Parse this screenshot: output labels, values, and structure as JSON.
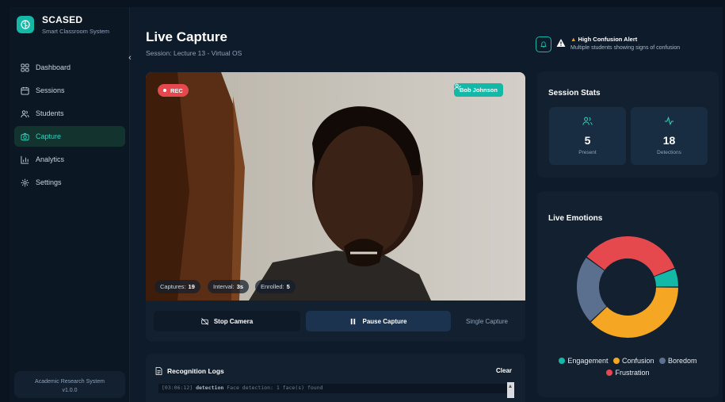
{
  "sidebar": {
    "brand_name": "SCASED",
    "brand_sub": "Smart Classroom System",
    "items": [
      {
        "label": "Dashboard",
        "icon": "grid-icon"
      },
      {
        "label": "Sessions",
        "icon": "calendar-icon"
      },
      {
        "label": "Students",
        "icon": "users-icon"
      },
      {
        "label": "Capture",
        "icon": "camera-icon"
      },
      {
        "label": "Analytics",
        "icon": "bar-chart-icon"
      },
      {
        "label": "Settings",
        "icon": "gear-icon"
      }
    ],
    "active": "Capture",
    "footer_line1": "Academic Research System",
    "footer_line2": "v1.0.0"
  },
  "header": {
    "title": "Live Capture",
    "subtitle": "Session: Lecture 13 - Virtual OS"
  },
  "alert": {
    "title": "High Confusion Alert",
    "message": "Multiple students showing signs of confusion"
  },
  "video": {
    "rec_label": "REC",
    "recognized_person": "Bob Johnson",
    "captures_label": "Captures:",
    "captures_value": "19",
    "interval_label": "Interval:",
    "interval_value": "3s",
    "enrolled_label": "Enrolled:",
    "enrolled_value": "5"
  },
  "controls": {
    "stop_label": "Stop Camera",
    "pause_label": "Pause Capture",
    "single_label": "Single Capture"
  },
  "logs": {
    "title": "Recognition Logs",
    "clear_label": "Clear",
    "line_prefix": "[03:06:12]",
    "line_keyword": "detection",
    "line_text": "Face detection: 1 face(s) found"
  },
  "stats": {
    "title": "Session Stats",
    "present_value": "5",
    "present_label": "Present",
    "detections_value": "18",
    "detections_label": "Detections"
  },
  "emotions": {
    "title": "Live Emotions",
    "legend": [
      {
        "name": "Engagement",
        "color": "#14b8a6"
      },
      {
        "name": "Confusion",
        "color": "#f5a623"
      },
      {
        "name": "Boredom",
        "color": "#5b6f8f"
      },
      {
        "name": "Frustration",
        "color": "#e5484d"
      }
    ]
  },
  "chart_data": {
    "type": "pie",
    "variant": "donut",
    "categories": [
      "Engagement",
      "Confusion",
      "Boredom",
      "Frustration"
    ],
    "values": [
      6,
      38,
      22,
      34
    ],
    "colors": [
      "#14b8a6",
      "#f5a623",
      "#5b6f8f",
      "#e5484d"
    ],
    "legend_position": "bottom"
  }
}
